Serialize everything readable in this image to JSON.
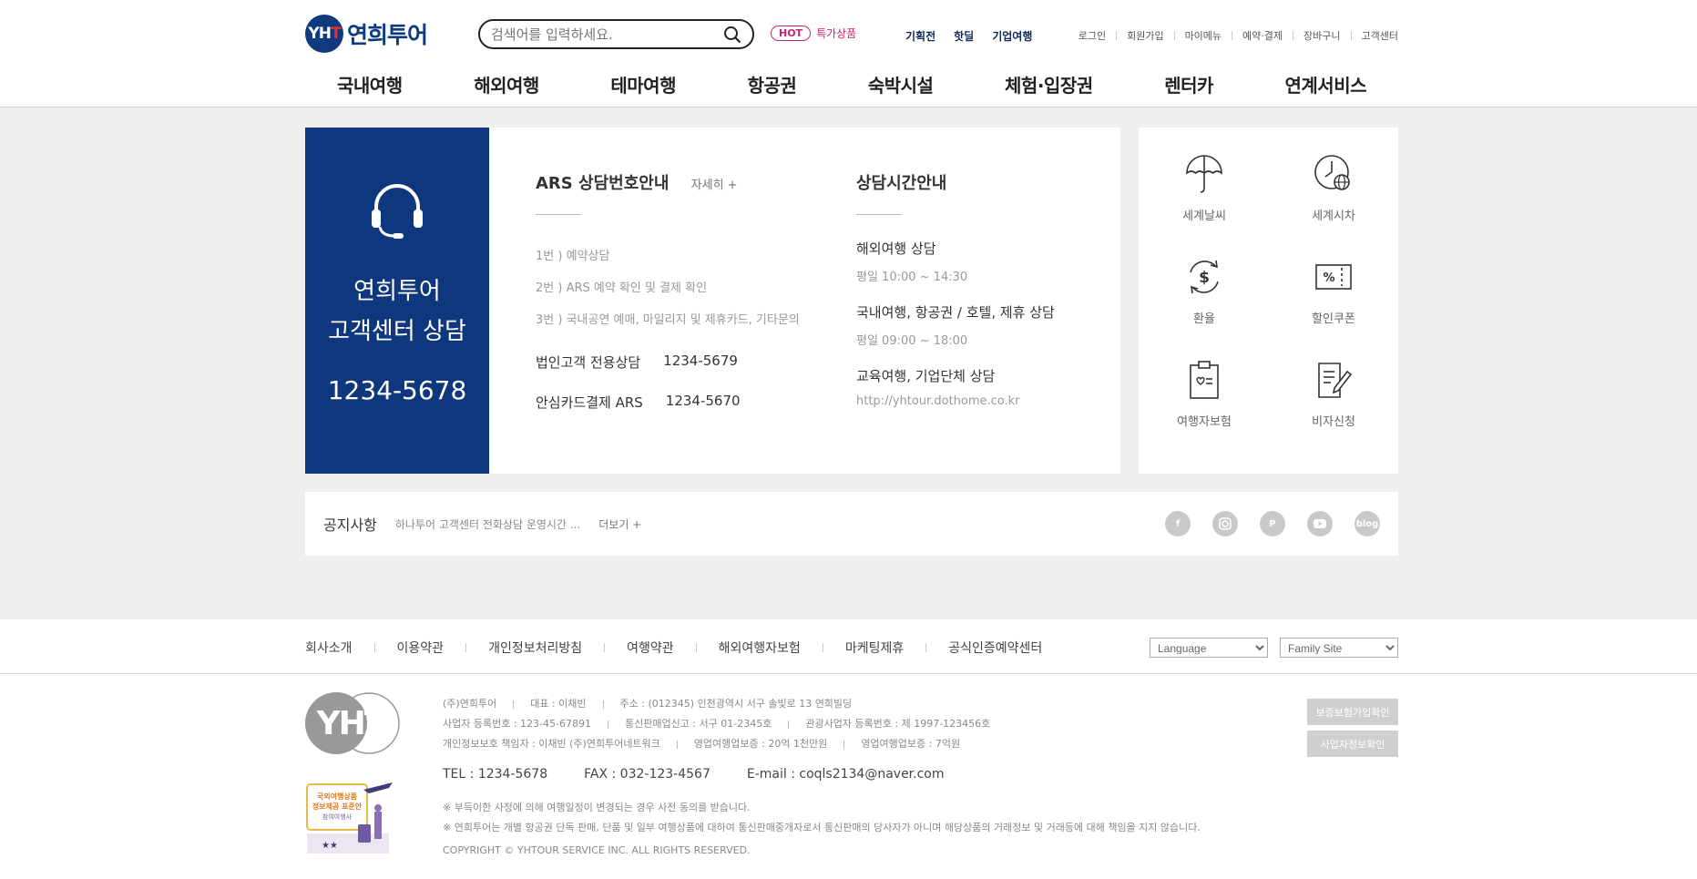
{
  "header": {
    "logo_mark": "YHT",
    "logo_text": "연희투어",
    "search_placeholder": "검색어를 입력하세요.",
    "hot_badge": "HOT",
    "hot_label": "특가상품",
    "quick_links": [
      "기획전",
      "핫딜",
      "기업여행"
    ],
    "util_links": [
      "로그인",
      "회원가입",
      "마이메뉴",
      "예약·결제",
      "장바구니",
      "고객센터"
    ]
  },
  "gnb": [
    "국내여행",
    "해외여행",
    "테마여행",
    "항공권",
    "숙박시설",
    "체험·입장권",
    "렌터카",
    "연계서비스"
  ],
  "customer_center": {
    "title_line1": "연희투어",
    "title_line2": "고객센터 상담",
    "phone": "1234-5678"
  },
  "ars": {
    "title": "ARS 상담번호안내",
    "more": "자세히 +",
    "items": [
      "1번 ) 예약상담",
      "2번 ) ARS 예약 확인 및 결제 확인",
      "3번 ) 국내공연 예매, 마일리지 및 제휴카드, 기타문의"
    ],
    "corp_label": "법인고객 전용상담",
    "corp_phone": "1234-5679",
    "card_label": "안심카드결제 ARS",
    "card_phone": "1234-5670"
  },
  "hours": {
    "title": "상담시간안내",
    "blocks": [
      {
        "head": "해외여행 상담",
        "text": "평일 10:00 ~ 14:30"
      },
      {
        "head": "국내여행, 항공권 / 호텔, 제휴 상담",
        "text": "평일 09:00 ~ 18:00"
      },
      {
        "head": "교육여행, 기업단체 상담",
        "text": "http://yhtour.dothome.co.kr"
      }
    ]
  },
  "services": [
    "세계날씨",
    "세계시차",
    "환율",
    "할인쿠폰",
    "여행자보험",
    "비자신청"
  ],
  "notice": {
    "title": "공지사항",
    "text": "하나투어 고객센터 전화상담 운영시간 ...",
    "more": "더보기 +",
    "social": [
      "f",
      "ig",
      "P",
      "yt",
      "blog"
    ]
  },
  "footer": {
    "links": [
      "회사소개",
      "이용약관",
      "개인정보처리방침",
      "여행약관",
      "해외여행자보험",
      "마케팅제휴",
      "공식인증예약센터"
    ],
    "language": "Language",
    "family_site": "Family Site",
    "info_row1": [
      "(주)연희투어",
      "대표 : 이채빈",
      "주소 : (012345) 인천광역시 서구 솔빛로 13 연희빌딩"
    ],
    "info_row2": [
      "사업자 등록번호 : 123-45-67891",
      "통신판매업신고 : 서구 01-2345호",
      "관광사업자 등록번호 : 제 1997-123456호"
    ],
    "info_row3": [
      "개인정보보호 책임자 : 이채빈 (주)연희투어네트워크",
      "영업여행업보증 : 20억 1천만원",
      "영업여행업보증 : 7억원"
    ],
    "tel": "TEL : 1234-5678",
    "fax": "FAX : 032-123-4567",
    "email": "E-mail : coqls2134@naver.com",
    "note1": "※ 부득이한 사정에 의해 여행일정이 변경되는 경우 사전 동의를 받습니다.",
    "note2": "※ 연희투어는 개별 항공권 단독 판매, 단품 및 일부 여행상품에 대하여 통신판매중개자로서 통신판매의 당사자가 아니며 해당상품의 거래정보 및 거래등에 대해 책임을 지지 않습니다.",
    "copyright": "COPYRIGHT © YHTOUR SERVICE INC. ALL RIGHTS RESERVED.",
    "btn1": "보증보험가입확인",
    "btn2": "사업자정보확인",
    "badge_lines": [
      "국외여행상품",
      "정보제공 표준안",
      "참여여행사"
    ]
  }
}
